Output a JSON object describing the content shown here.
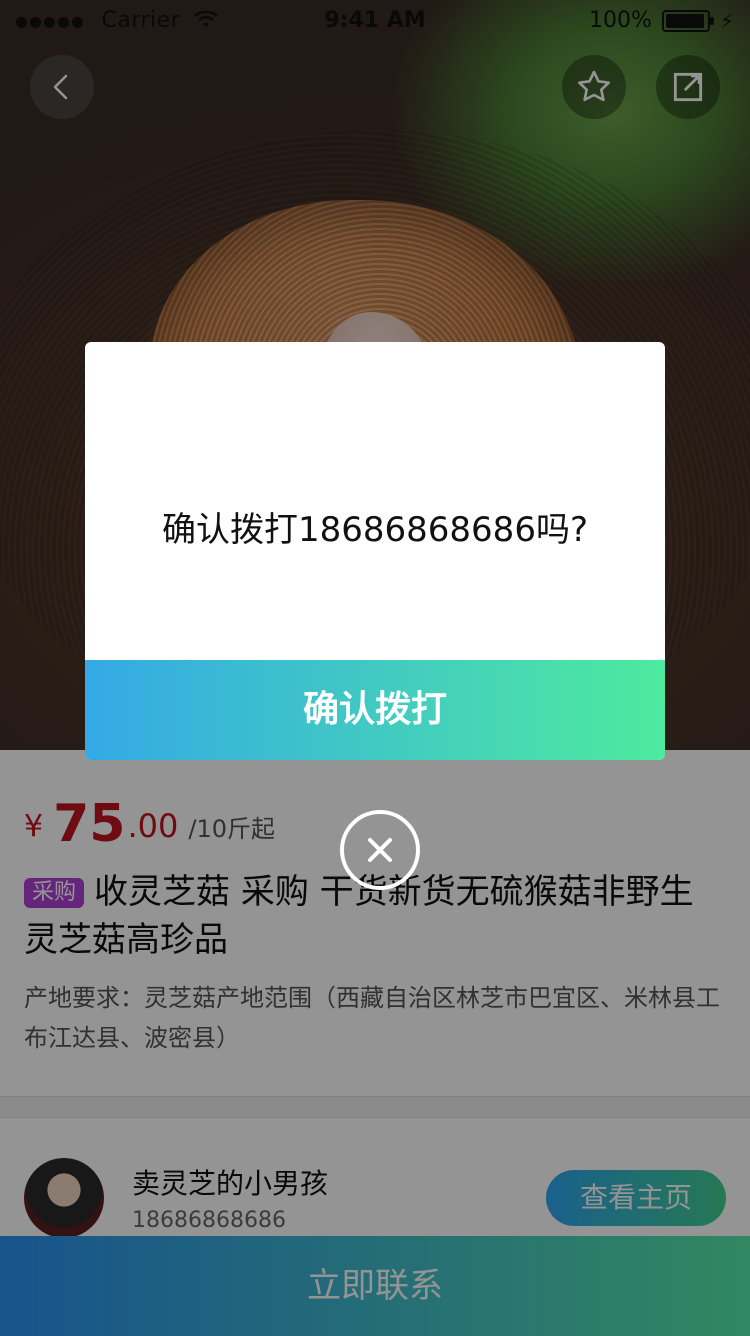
{
  "status_bar": {
    "carrier": "Carrier",
    "time": "9:41 AM",
    "battery": "100%"
  },
  "product": {
    "price_symbol": "¥",
    "price_int": "75",
    "price_dec": ".00",
    "unit": "/10斤起",
    "badge": "采购",
    "title": "收灵芝菇 采购 干货新货无硫猴菇非野生灵芝菇高珍品",
    "origin": "产地要求：灵芝菇产地范围（西藏自治区林芝市巴宜区、米林县工布江达县、波密县）"
  },
  "seller": {
    "name": "卖灵芝的小男孩",
    "phone": "18686868686",
    "view_label": "查看主页"
  },
  "cta": {
    "label": "立即联系"
  },
  "dialog": {
    "message": "确认拨打18686868686吗?",
    "confirm_label": "确认拨打"
  },
  "icons": {
    "back": "back-icon",
    "favorite": "star-icon",
    "share": "share-icon",
    "close": "close-icon"
  }
}
